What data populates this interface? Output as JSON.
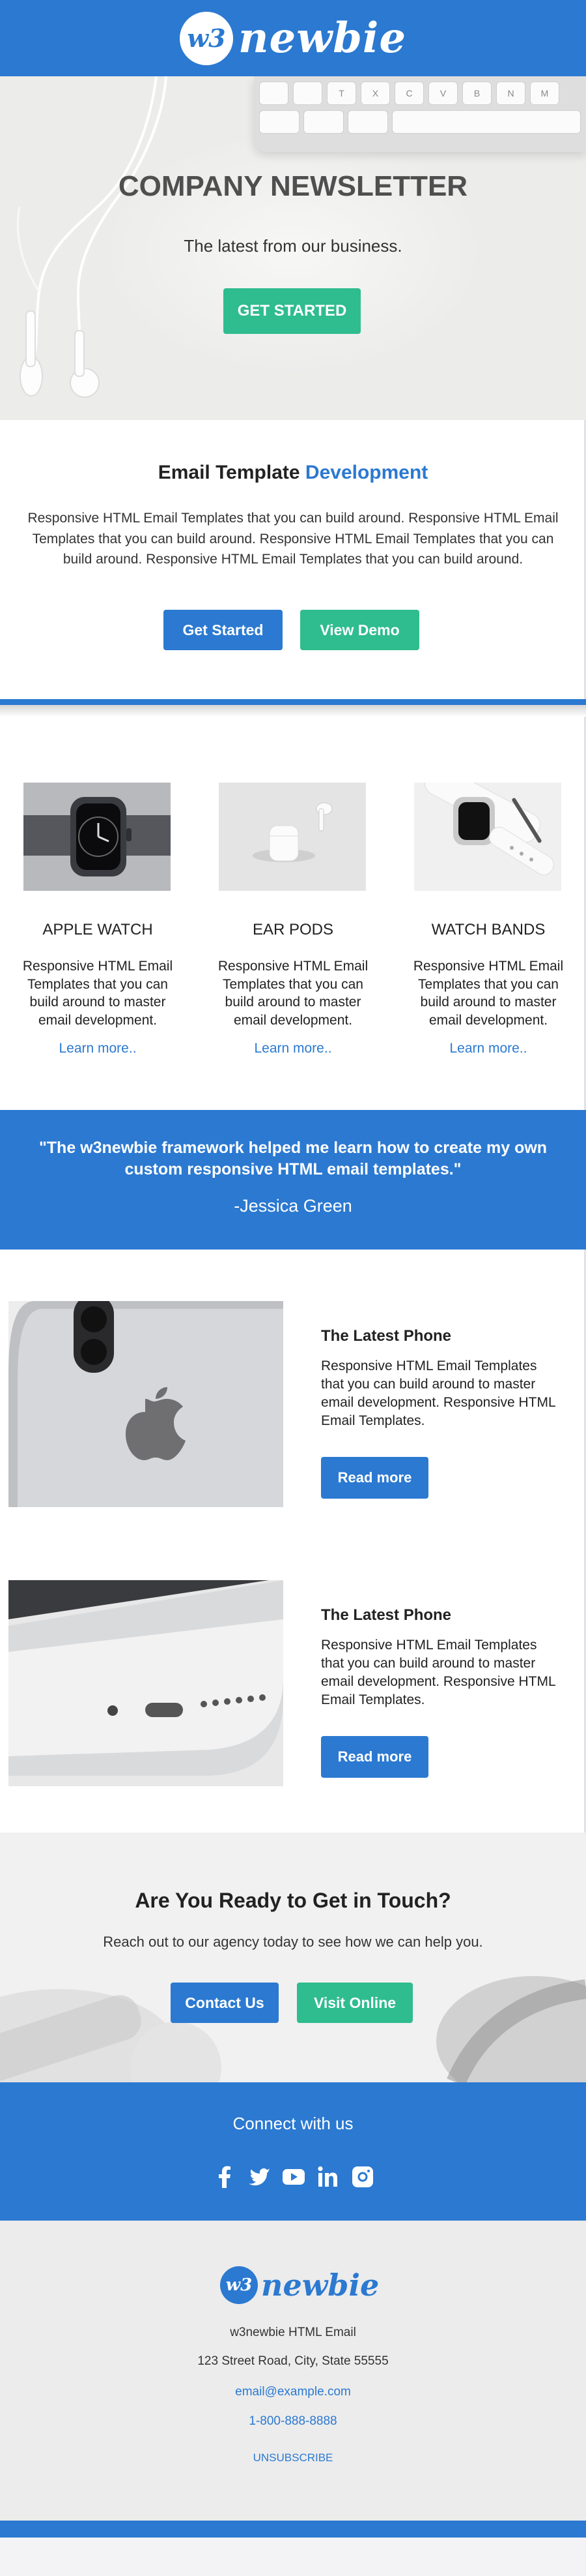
{
  "header": {
    "logo_mark": "w3",
    "logo_text": "newbie"
  },
  "hero": {
    "keys_row1": [
      "",
      "",
      "T",
      "X",
      "C",
      "V",
      "B",
      "N",
      "M",
      ""
    ],
    "title": "COMPANY NEWSLETTER",
    "subtitle": "The latest from our business.",
    "cta": "GET STARTED"
  },
  "intro": {
    "title_plain": "Email Template",
    "title_accent": "Development",
    "body": "Responsive HTML Email Templates that you can build around. Responsive HTML Email Templates that you can build around. Responsive HTML Email Templates that you can build around. Responsive HTML Email Templates that you can build around.",
    "button_primary": "Get Started",
    "button_secondary": "View Demo"
  },
  "products": [
    {
      "title": "APPLE WATCH",
      "body": "Responsive HTML Email Templates that you can build around to master email development.",
      "link": "Learn more.."
    },
    {
      "title": "EAR PODS",
      "body": "Responsive HTML Email Templates that you can build around to master email development.",
      "link": "Learn more.."
    },
    {
      "title": "WATCH BANDS",
      "body": "Responsive HTML Email Templates that you can build around to master email development.",
      "link": "Learn more.."
    }
  ],
  "quote": {
    "text": "\"The w3newbie framework helped me learn how to create my own custom responsive HTML email templates.\"",
    "author": "-Jessica Green"
  },
  "features": [
    {
      "title": "The Latest Phone",
      "body": "Responsive HTML Email Templates that you can build around to master email development. Responsive HTML Email Templates.",
      "button": "Read more"
    },
    {
      "title": "The Latest Phone",
      "body": "Responsive HTML Email Templates that you can build around to master email development. Responsive HTML Email Templates.",
      "button": "Read more"
    }
  ],
  "contact": {
    "title": "Are You Ready to Get in Touch?",
    "body": "Reach out to our agency today to see how we can help you.",
    "button_primary": "Contact Us",
    "button_secondary": "Visit Online"
  },
  "connect": {
    "title": "Connect with us",
    "icons": [
      "facebook-icon",
      "twitter-icon",
      "youtube-icon",
      "linkedin-icon",
      "instagram-icon"
    ]
  },
  "footer": {
    "logo_mark": "w3",
    "logo_text": "newbie",
    "company": "w3newbie HTML Email",
    "address": "123 Street Road, City, State 55555",
    "email": "email@example.com",
    "phone": "1-800-888-8888",
    "unsubscribe": "UNSUBSCRIBE"
  },
  "colors": {
    "primary": "#2b79d1",
    "accent": "#2fbc8e",
    "heading": "#4f4f4f",
    "footer_bg": "#ececec"
  }
}
